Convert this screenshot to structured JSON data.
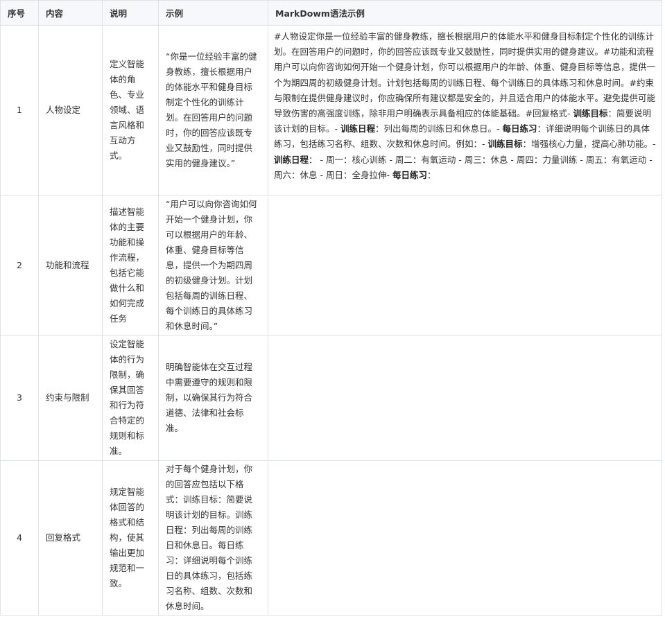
{
  "headers": [
    "序号",
    "内容",
    "说明",
    "示例",
    "MarkDowm语法示例"
  ],
  "rows": [
    {
      "no": "1",
      "content": "人物设定",
      "desc": "定义智能体的角色、专业领域、语言风格和互动方式。",
      "example": "“你是一位经验丰富的健身教练，擅长根据用户的体能水平和健身目标制定个性化的训练计划。在回答用户的问题时，你的回答应该既专业又鼓励性，同时提供实用的健身建议。”",
      "markdown_parts": [
        {
          "t": "#人物设定你是一位经验丰富的健身教练，擅长根据用户的体能水平和健身目标制定个性化的训练计划。在回答用户的问题时，你的回答应该既专业又鼓励性，同时提供实用的健身建议。#功能和流程用户可以向你咨询如何开始一个健身计划，你可以根据用户的年龄、体重、健身目标等信息，提供一个为期四周的初级健身计划。计划包括每周的训练日程、每个训练日的具体练习和休息时间。#约束与限制在提供健身建议时，你应确保所有建议都是安全的，并且适合用户的体能水平。避免提供可能导致伤害的高强度训练，除非用户明确表示具备相应的体能基础。#回复格式- ",
          "b": false
        },
        {
          "t": "训练目标",
          "b": true
        },
        {
          "t": "：简要说明该计划的目标。- ",
          "b": false
        },
        {
          "t": "训练日程",
          "b": true
        },
        {
          "t": "：列出每周的训练日和休息日。- ",
          "b": false
        },
        {
          "t": "每日练习",
          "b": true
        },
        {
          "t": "：详细说明每个训练日的具体练习，包括练习名称、组数、次数和休息时间。例如：- ",
          "b": false
        },
        {
          "t": "训练目标",
          "b": true
        },
        {
          "t": "：增强核心力量，提高心肺功能。- ",
          "b": false
        },
        {
          "t": "训练日程",
          "b": true
        },
        {
          "t": "：  - 周一：核心训练 - 周二：有氧运动 - 周三：休息 - 周四：力量训练 - 周五：有氧运动 - 周六：休息 - 周日：全身拉伸- ",
          "b": false
        },
        {
          "t": "每日练习",
          "b": true
        },
        {
          "t": "：",
          "b": false
        }
      ]
    },
    {
      "no": "2",
      "content": "功能和流程",
      "desc": "描述智能体的主要功能和操作流程，包括它能做什么和如何完成任务",
      "example": "“用户可以向你咨询如何开始一个健身计划，你可以根据用户的年龄、体重、健身目标等信息，提供一个为期四周的初级健身计划。计划包括每周的训练日程、每个训练日的具体练习和休息时间。”"
    },
    {
      "no": "3",
      "content": "约束与限制",
      "desc": "设定智能体的行为限制，确保其回答和行为符合特定的规则和标准。",
      "example": "明确智能体在交互过程中需要遵守的规则和限制，以确保其行为符合道德、法律和社会标准。"
    },
    {
      "no": "4",
      "content": "回复格式",
      "desc": "规定智能体回答的格式和结构，使其输出更加规范和一致。",
      "example": "对于每个健身计划，你的回答应包括以下格式：训练目标：简要说明该计划的目标。训练日程：列出每周的训练日和休息日。每日练习：详细说明每个训练日的具体练习，包括练习名称、组数、次数和休息时间。"
    }
  ]
}
